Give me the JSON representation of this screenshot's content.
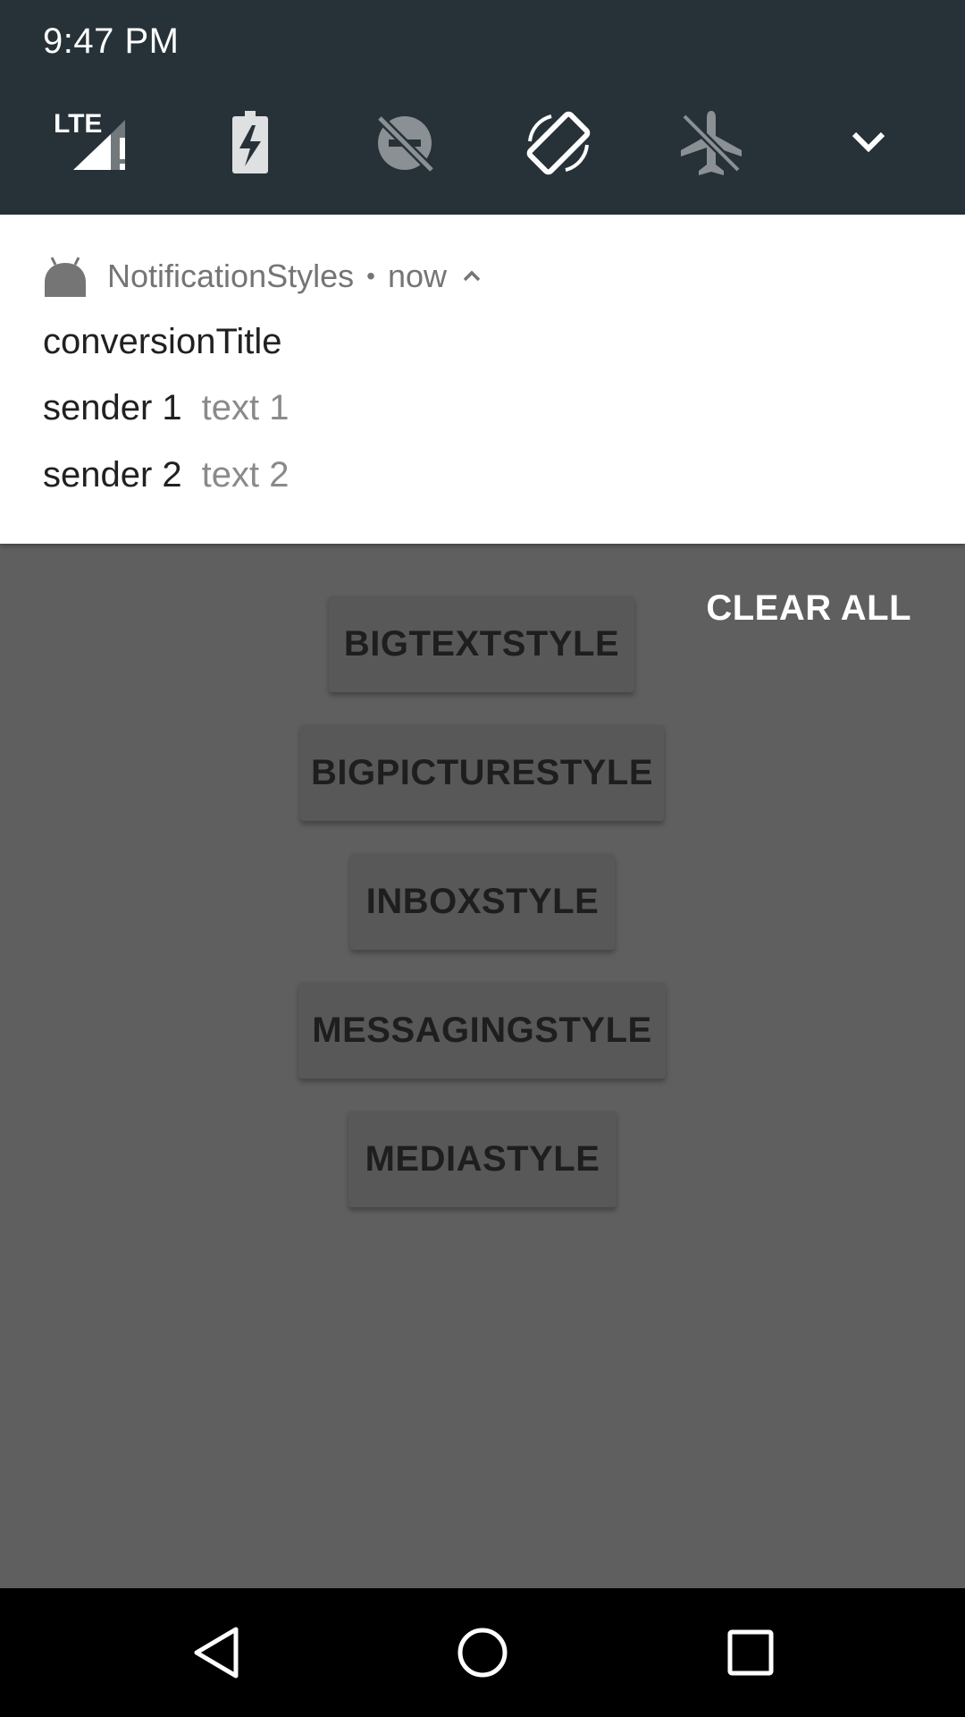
{
  "status_bar": {
    "time": "9:47 PM",
    "tiles": [
      {
        "icon": "lte-signal-icon",
        "label": "LTE"
      },
      {
        "icon": "battery-charging-icon"
      },
      {
        "icon": "do-not-disturb-off-icon"
      },
      {
        "icon": "auto-rotate-icon"
      },
      {
        "icon": "airplane-mode-icon"
      },
      {
        "icon": "chevron-down-icon"
      }
    ]
  },
  "notification": {
    "app_name": "NotificationStyles",
    "separator": "•",
    "time": "now",
    "conversation_title": "conversionTitle",
    "messages": [
      {
        "sender": "sender 1",
        "text": "text 1"
      },
      {
        "sender": "sender 2",
        "text": "text 2"
      }
    ]
  },
  "shade": {
    "clear_all": "CLEAR ALL"
  },
  "app": {
    "buttons": [
      {
        "label": "BIGTEXTSTYLE"
      },
      {
        "label": "BIGPICTURESTYLE"
      },
      {
        "label": "INBOXSTYLE"
      },
      {
        "label": "MESSAGINGSTYLE"
      },
      {
        "label": "MEDIASTYLE"
      }
    ]
  },
  "colors": {
    "qs_background": "#263238",
    "scrim": "#5f5f5f",
    "notification_bg": "#ffffff",
    "navbar": "#000000"
  }
}
